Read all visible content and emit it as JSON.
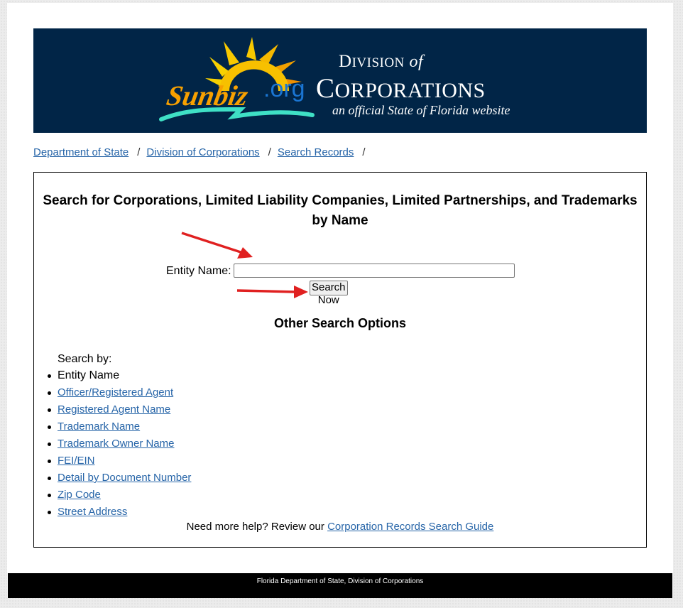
{
  "banner": {
    "logo_text": "Sunbiz",
    "logo_domain": ".org",
    "division_prefix": "D",
    "division_rest": "IVISION",
    "division_of": "of",
    "corp_first": "C",
    "corp_rest": "ORPORATIONS",
    "tagline": "an official State of Florida website",
    "colors": {
      "background": "#012547",
      "sun": "#f7c800",
      "org": "#1a75d2",
      "wave": "#3fe0c5"
    }
  },
  "breadcrumb": {
    "items": [
      {
        "label": "Department of State"
      },
      {
        "label": "Division of Corporations"
      },
      {
        "label": "Search Records"
      }
    ],
    "separator": "/"
  },
  "search": {
    "title_line1": "Search for Corporations, Limited Liability Companies, Limited Partnerships, and Trademarks",
    "title_line2": "by Name",
    "entity_label": "Entity Name:",
    "entity_value": "",
    "entity_placeholder": "",
    "submit_label": "Search Now"
  },
  "other_options": {
    "title": "Other Search Options",
    "search_by_label": "Search by:",
    "items": [
      {
        "label": "Entity Name",
        "link": false
      },
      {
        "label": "Officer/Registered Agent",
        "link": true
      },
      {
        "label": "Registered Agent Name",
        "link": true
      },
      {
        "label": "Trademark Name",
        "link": true
      },
      {
        "label": "Trademark Owner Name",
        "link": true
      },
      {
        "label": "FEI/EIN",
        "link": true
      },
      {
        "label": "Detail by Document Number",
        "link": true
      },
      {
        "label": "Zip Code",
        "link": true
      },
      {
        "label": "Street Address",
        "link": true
      }
    ]
  },
  "help": {
    "text": "Need more help? Review our ",
    "link_label": "Corporation Records Search Guide"
  },
  "footer": {
    "text": "Florida Department of State, Division of Corporations"
  },
  "annotations": {
    "arrow_color": "#e02020"
  }
}
